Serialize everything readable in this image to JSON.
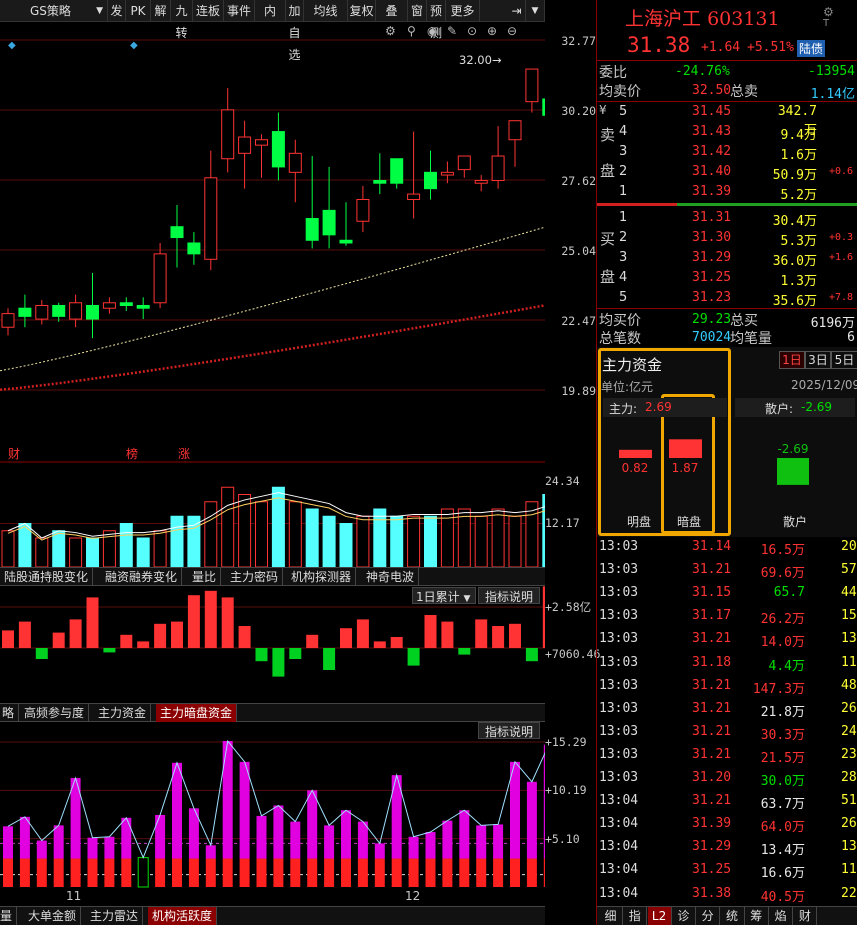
{
  "toolbar": {
    "strategy": "GS策略",
    "items": [
      "发",
      "PK",
      "解",
      "九转",
      "连板",
      "事件",
      "内",
      "加自选",
      "均线",
      "复权",
      "叠",
      "窗",
      "预测",
      "更多"
    ]
  },
  "price_axis": [
    "32.77",
    "30.20",
    "27.62",
    "25.04",
    "22.47",
    "19.89"
  ],
  "high_marker": "32.00",
  "kline_tags": [
    "财",
    "榜",
    "涨"
  ],
  "vol_axis": [
    "24.34",
    "12.17"
  ],
  "tabs1": [
    "陆股通持股变化",
    "融资融券变化",
    "量比",
    "主力密码",
    "机构探测器",
    "神奇电波"
  ],
  "dropdown_1d": "1日累计",
  "indicator_btn": "指标说明",
  "fund_axis": [
    "+2.58亿",
    "+7060.46"
  ],
  "tabs2": [
    "略",
    "高频参与度",
    "主力资金",
    "主力暗盘资金"
  ],
  "act_axis": [
    "+15.29",
    "+10.19",
    "+5.10"
  ],
  "xdates": [
    "11",
    "12"
  ],
  "tabs3": [
    "量",
    "大单金额",
    "主力雷达",
    "机构活跃度"
  ],
  "stock": {
    "name": "上海沪工",
    "code": "603131",
    "price": "31.38",
    "chg": "+1.64",
    "pct": "+5.51%",
    "tag": "陆债"
  },
  "wb": {
    "label": "委比",
    "val": "-24.76%",
    "diff": "-13954"
  },
  "avgsell": {
    "label": "均卖价",
    "val": "32.50",
    "tlabel": "总卖",
    "tval": "1.14亿"
  },
  "sell": [
    {
      "n": "5",
      "p": "31.45",
      "v": "342.7万",
      "x": ""
    },
    {
      "n": "4",
      "p": "31.43",
      "v": "9.4万",
      "x": ""
    },
    {
      "n": "3",
      "p": "31.42",
      "v": "1.6万",
      "x": ""
    },
    {
      "n": "2",
      "p": "31.40",
      "v": "50.9万",
      "x": "+0.6"
    },
    {
      "n": "1",
      "p": "31.39",
      "v": "5.2万",
      "x": ""
    }
  ],
  "sell_label": [
    "¥",
    "卖",
    "盘"
  ],
  "buy": [
    {
      "n": "1",
      "p": "31.31",
      "v": "30.4万",
      "x": ""
    },
    {
      "n": "2",
      "p": "31.30",
      "v": "5.3万",
      "x": "+0.3"
    },
    {
      "n": "3",
      "p": "31.29",
      "v": "36.0万",
      "x": "+1.6"
    },
    {
      "n": "4",
      "p": "31.25",
      "v": "1.3万",
      "x": ""
    },
    {
      "n": "5",
      "p": "31.23",
      "v": "35.6万",
      "x": "+7.8"
    }
  ],
  "buy_label": [
    "买",
    "盘"
  ],
  "avgbuy": {
    "label": "均买价",
    "val": "29.23",
    "tlabel": "总买",
    "tval": "6196万"
  },
  "total": {
    "label": "总笔数",
    "val": "70024",
    "alabel": "均笔量",
    "aval": "6"
  },
  "zl": {
    "title": "主力资金",
    "unit": "单位:亿元",
    "date": "2025/12/09",
    "periods": [
      "1日",
      "3日",
      "5日"
    ],
    "main_label": "主力:",
    "main_val": "2.69",
    "retail_label": "散户:",
    "retail_val": "-2.69",
    "bars": [
      {
        "label": "明盘",
        "val": "0.82",
        "v": 0.82
      },
      {
        "label": "暗盘",
        "val": "1.87",
        "v": 1.87
      },
      {
        "label": "散户",
        "val": "-2.69",
        "v": -2.69
      }
    ]
  },
  "ticks": [
    {
      "t": "13:03",
      "p": "31.14",
      "v": "16.5万",
      "n": "20",
      "pc": "red",
      "vc": "red"
    },
    {
      "t": "13:03",
      "p": "31.21",
      "v": "69.6万",
      "n": "57",
      "pc": "red",
      "vc": "red"
    },
    {
      "t": "13:03",
      "p": "31.15",
      "v": "65.7",
      "n": "44",
      "pc": "red",
      "vc": "grn"
    },
    {
      "t": "13:03",
      "p": "31.17",
      "v": "26.2万",
      "n": "15",
      "pc": "red",
      "vc": "red"
    },
    {
      "t": "13:03",
      "p": "31.21",
      "v": "14.0万",
      "n": "13",
      "pc": "red",
      "vc": "red"
    },
    {
      "t": "13:03",
      "p": "31.18",
      "v": "4.4万",
      "n": "11",
      "pc": "red",
      "vc": "grn"
    },
    {
      "t": "13:03",
      "p": "31.21",
      "v": "147.3万",
      "n": "48",
      "pc": "red",
      "vc": "red"
    },
    {
      "t": "13:03",
      "p": "31.21",
      "v": "21.8万",
      "n": "26",
      "pc": "red",
      "vc": "wht"
    },
    {
      "t": "13:03",
      "p": "31.21",
      "v": "30.3万",
      "n": "24",
      "pc": "red",
      "vc": "red"
    },
    {
      "t": "13:03",
      "p": "31.21",
      "v": "21.5万",
      "n": "23",
      "pc": "red",
      "vc": "red"
    },
    {
      "t": "13:03",
      "p": "31.20",
      "v": "30.0万",
      "n": "28",
      "pc": "red",
      "vc": "grn"
    },
    {
      "t": "13:04",
      "p": "31.21",
      "v": "63.7万",
      "n": "51",
      "pc": "red",
      "vc": "wht"
    },
    {
      "t": "13:04",
      "p": "31.39",
      "v": "64.0万",
      "n": "26",
      "pc": "red",
      "vc": "red"
    },
    {
      "t": "13:04",
      "p": "31.29",
      "v": "13.4万",
      "n": "13",
      "pc": "red",
      "vc": "wht"
    },
    {
      "t": "13:04",
      "p": "31.25",
      "v": "16.6万",
      "n": "11",
      "pc": "red",
      "vc": "wht"
    },
    {
      "t": "13:04",
      "p": "31.38",
      "v": "40.5万",
      "n": "22",
      "pc": "red",
      "vc": "red"
    }
  ],
  "bottom_tabs": [
    "细",
    "指",
    "L2",
    "诊",
    "分",
    "统",
    "筹",
    "焰",
    "财"
  ],
  "chart_data": {
    "type": "candlestick",
    "candles": [
      [
        22.2,
        22.7,
        21.9,
        22.9
      ],
      [
        22.9,
        22.6,
        22.2,
        23.4
      ],
      [
        22.5,
        23.0,
        22.3,
        23.2
      ],
      [
        23.0,
        22.6,
        22.4,
        23.1
      ],
      [
        22.5,
        23.1,
        22.2,
        23.4
      ],
      [
        23.0,
        22.5,
        21.8,
        24.2
      ],
      [
        22.9,
        23.1,
        22.7,
        23.3
      ],
      [
        23.1,
        23.0,
        22.8,
        23.3
      ],
      [
        23.0,
        22.9,
        22.5,
        23.3
      ],
      [
        23.1,
        24.9,
        22.9,
        25.3
      ],
      [
        25.9,
        25.5,
        24.4,
        26.7
      ],
      [
        25.3,
        24.9,
        24.5,
        25.7
      ],
      [
        24.7,
        27.7,
        24.3,
        28.7
      ],
      [
        28.4,
        30.2,
        27.9,
        31.0
      ],
      [
        28.6,
        29.2,
        27.3,
        29.8
      ],
      [
        28.9,
        29.1,
        27.7,
        29.3
      ],
      [
        29.4,
        28.1,
        27.6,
        30.1
      ],
      [
        27.9,
        28.6,
        26.8,
        29.1
      ],
      [
        26.2,
        25.4,
        25.1,
        28.5
      ],
      [
        26.5,
        25.6,
        25.1,
        28.1
      ],
      [
        25.4,
        25.3,
        25.2,
        26.8
      ],
      [
        26.1,
        26.9,
        25.7,
        27.4
      ],
      [
        27.6,
        27.5,
        27.1,
        28.6
      ],
      [
        28.4,
        27.5,
        27.3,
        28.3
      ],
      [
        26.9,
        27.1,
        26.2,
        29.4
      ],
      [
        27.9,
        27.3,
        26.9,
        28.7
      ],
      [
        27.8,
        27.9,
        27.5,
        28.3
      ],
      [
        28.0,
        28.5,
        27.7,
        28.4
      ],
      [
        27.5,
        27.6,
        27.2,
        27.8
      ],
      [
        27.6,
        28.5,
        27.3,
        29.6
      ],
      [
        29.1,
        29.8,
        28.1,
        29.6
      ],
      [
        30.5,
        31.7,
        30.1,
        31.4
      ],
      [
        30.6,
        30.0,
        29.4,
        31.6
      ],
      [
        29.5,
        31.4,
        29.4,
        32.0
      ]
    ],
    "ma1_end": 26.2,
    "ma2_end": 23.2,
    "volume": [
      5,
      6,
      4,
      5,
      4,
      4,
      5,
      6,
      4,
      5,
      7,
      7,
      9,
      11,
      10,
      9,
      11,
      9,
      8,
      7,
      6,
      7,
      8,
      7,
      7,
      7,
      8,
      8,
      7,
      8,
      7,
      9,
      10,
      8
    ],
    "fund": [
      0.8,
      1.2,
      -0.5,
      0.7,
      1.3,
      2.3,
      -0.2,
      0.6,
      0.3,
      1.1,
      1.2,
      2.4,
      2.6,
      2.3,
      1.0,
      -0.6,
      -1.3,
      -0.5,
      0.6,
      -1.0,
      0.9,
      1.3,
      0.3,
      0.5,
      -0.8,
      1.5,
      1.2,
      -0.3,
      1.3,
      1.0,
      1.1,
      -0.6,
      2.8,
      1.9
    ],
    "activity": [
      6.4,
      7.4,
      4.9,
      6.5,
      11.5,
      5.2,
      5.3,
      7.3,
      3.1,
      7.6,
      13.1,
      8.3,
      4.4,
      15.4,
      13.2,
      7.5,
      8.6,
      6.9,
      10.2,
      6.5,
      8.1,
      6.9,
      4.6,
      11.8,
      5.3,
      5.8,
      7.0,
      8.1,
      6.5,
      6.6,
      13.2,
      11.1,
      15.0,
      13.2
    ]
  }
}
